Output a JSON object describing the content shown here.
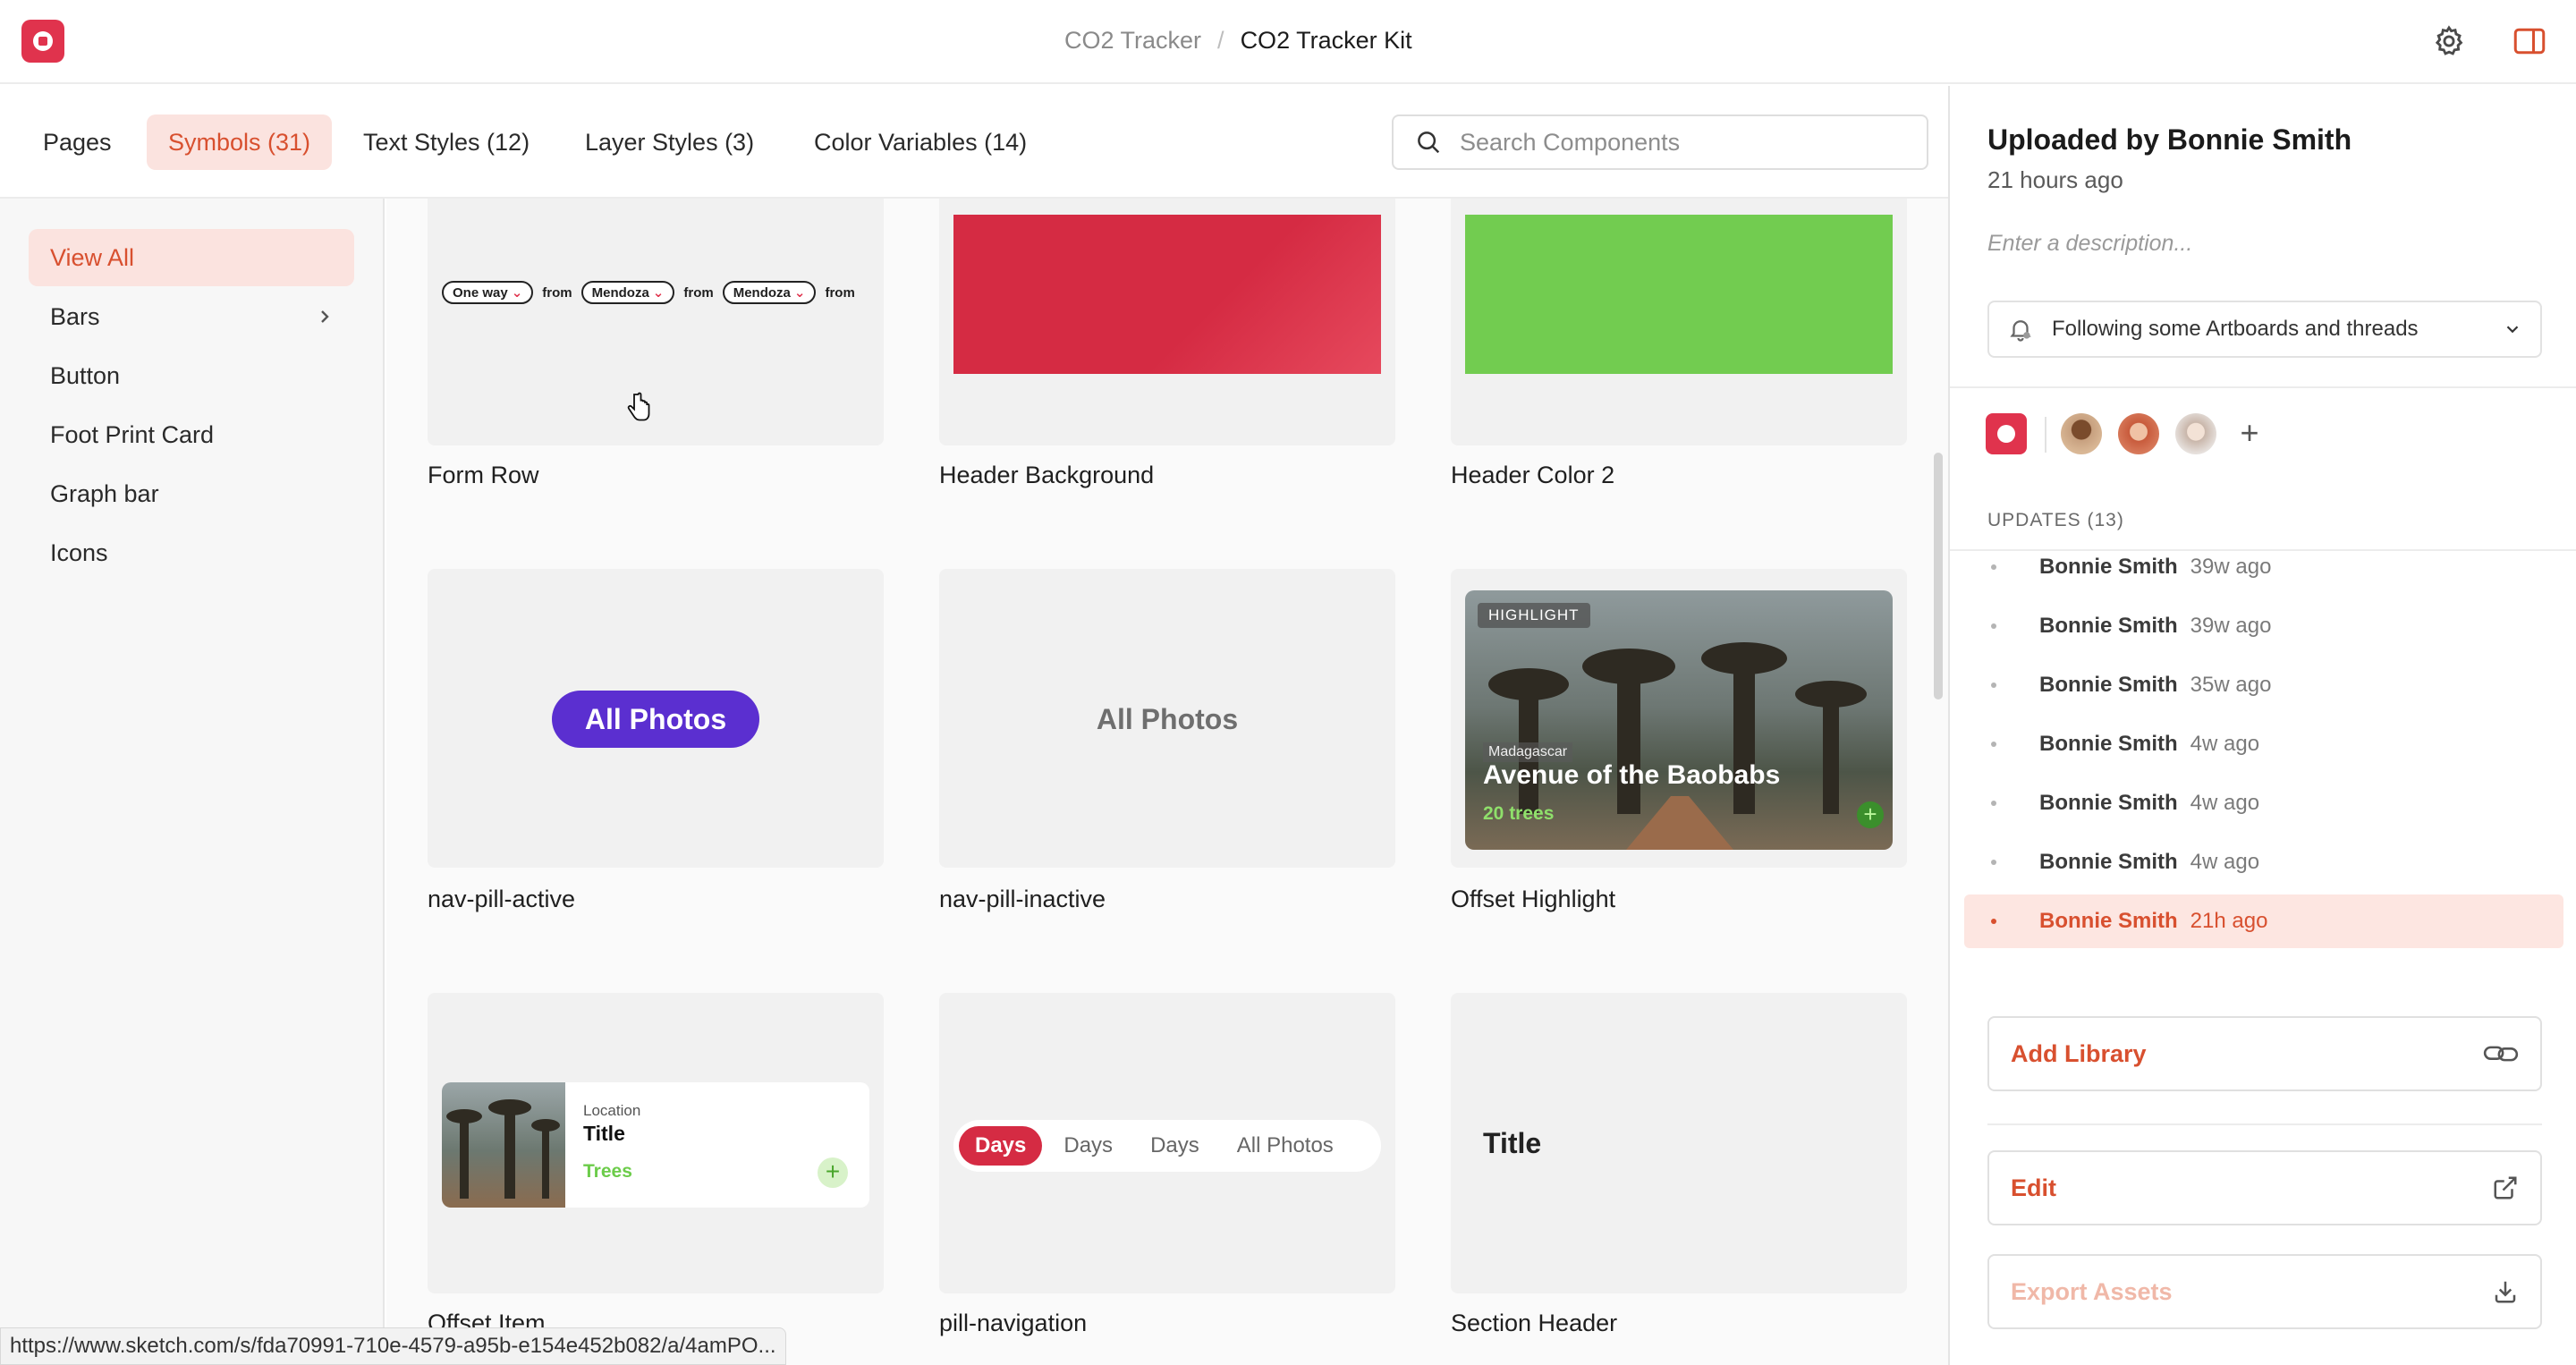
{
  "header": {
    "breadcrumb_parent": "CO2 Tracker",
    "breadcrumb_separator": "/",
    "breadcrumb_current": "CO2 Tracker Kit"
  },
  "tabs": [
    {
      "label": "Pages"
    },
    {
      "label": "Symbols (31)"
    },
    {
      "label": "Text Styles (12)"
    },
    {
      "label": "Layer Styles (3)"
    },
    {
      "label": "Color Variables (14)"
    }
  ],
  "search": {
    "placeholder": "Search Components"
  },
  "sidebar": {
    "items": [
      {
        "label": "View All"
      },
      {
        "label": "Bars"
      },
      {
        "label": "Button"
      },
      {
        "label": "Foot Print Card"
      },
      {
        "label": "Graph bar"
      },
      {
        "label": "Icons"
      }
    ]
  },
  "cards": [
    {
      "label": "Form Row"
    },
    {
      "label": "Header Background"
    },
    {
      "label": "Header Color 2"
    },
    {
      "label": "nav-pill-active"
    },
    {
      "label": "nav-pill-inactive"
    },
    {
      "label": "Offset Highlight"
    },
    {
      "label": "Offset Item"
    },
    {
      "label": "pill-navigation"
    },
    {
      "label": "Section Header"
    }
  ],
  "thumbs": {
    "form_row": {
      "one_way": "One way",
      "from": "from",
      "city": "Mendoza"
    },
    "nav_pill_label": "All Photos",
    "highlight": {
      "tag": "HIGHLIGHT",
      "region": "Madagascar",
      "title": "Avenue of the Baobabs",
      "count": "20 trees"
    },
    "offset_item": {
      "location": "Location",
      "title": "Title",
      "trees": "Trees"
    },
    "pill_nav": [
      "Days",
      "Days",
      "Days",
      "All Photos"
    ],
    "section_title": "Title"
  },
  "colors": {
    "accent": "#d8502f",
    "brand_red": "#e0334d",
    "header_bg_red": "#d52b43",
    "header_green": "#72cc50",
    "nav_pill_purple": "#5b2fd0"
  },
  "right_panel": {
    "title": "Uploaded by Bonnie Smith",
    "subtitle": "21 hours ago",
    "description_placeholder": "Enter a description...",
    "follow_label": "Following some Artboards and threads",
    "updates_header": "UPDATES (13)",
    "updates": [
      {
        "name": "Bonnie Smith",
        "time": "39w ago"
      },
      {
        "name": "Bonnie Smith",
        "time": "39w ago"
      },
      {
        "name": "Bonnie Smith",
        "time": "35w ago"
      },
      {
        "name": "Bonnie Smith",
        "time": "4w ago"
      },
      {
        "name": "Bonnie Smith",
        "time": "4w ago"
      },
      {
        "name": "Bonnie Smith",
        "time": "4w ago"
      },
      {
        "name": "Bonnie Smith",
        "time": "21h ago"
      }
    ],
    "buttons": {
      "add_library": "Add Library",
      "edit": "Edit",
      "export_assets": "Export Assets"
    }
  },
  "status_url": "https://www.sketch.com/s/fda70991-710e-4579-a95b-e154e452b082/a/4amPO..."
}
